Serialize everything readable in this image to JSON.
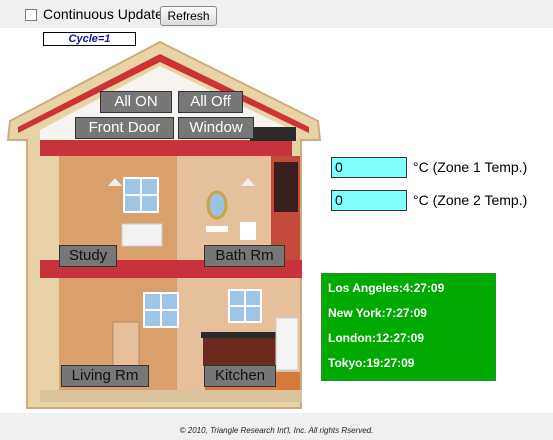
{
  "toolbar": {
    "continuous_update_label": "Continuous Update",
    "refresh_label": "Refresh"
  },
  "cycle_text": "Cycle=1",
  "house_buttons": {
    "all_on": "All ON",
    "all_off": "All Off",
    "front_door": "Front Door",
    "window": "Window",
    "study": "Study",
    "bath_rm": "Bath Rm",
    "living_rm": "Living Rm",
    "kitchen": "Kitchen"
  },
  "zone1": {
    "value": "0",
    "label": "°C (Zone 1 Temp.)"
  },
  "zone2": {
    "value": "0",
    "label": "°C (Zone 2 Temp.)"
  },
  "clocks": [
    "Los Angeles:4:27:09",
    "New York:7:27:09",
    "London:12:27:09",
    "Tokyo:19:27:09"
  ],
  "footer": "© 2010, Triangle Research Int'l, Inc. All rights Rserved.",
  "colors": {
    "roof_red": "#cc3333",
    "clock_green": "#00aa00",
    "temp_field": "#7fffff",
    "button_gray": "#777777"
  }
}
